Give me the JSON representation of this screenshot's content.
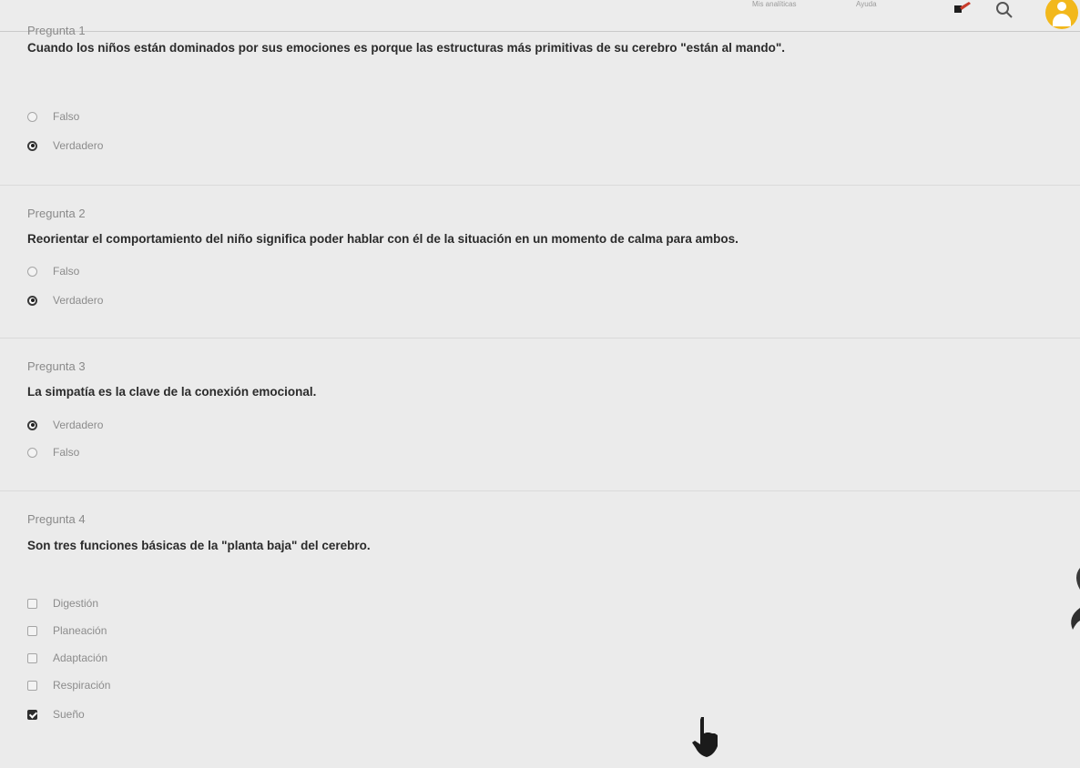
{
  "topbar": {
    "results_link": "Mis analíticas",
    "help_link": "Ayuda",
    "icons": [
      "notification-icon",
      "search-icon",
      "user-avatar"
    ]
  },
  "questions": [
    {
      "number": "Pregunta 1",
      "text": "Cuando los niños están dominados por sus emociones es porque las estructuras más primitivas de su cerebro \"están al mando\".",
      "type": "radio",
      "options": [
        {
          "label": "Falso",
          "checked": false
        },
        {
          "label": "Verdadero",
          "checked": true
        }
      ]
    },
    {
      "number": "Pregunta 2",
      "text": "Reorientar el comportamiento del niño significa poder hablar con él de la situación en un momento de calma para ambos.",
      "type": "radio",
      "options": [
        {
          "label": "Falso",
          "checked": false
        },
        {
          "label": "Verdadero",
          "checked": true
        }
      ]
    },
    {
      "number": "Pregunta 3",
      "text": "La simpatía es la clave de la conexión emocional.",
      "type": "radio",
      "options": [
        {
          "label": "Verdadero",
          "checked": true
        },
        {
          "label": "Falso",
          "checked": false
        }
      ]
    },
    {
      "number": "Pregunta 4",
      "text": "Son tres funciones básicas de la \"planta baja\" del cerebro.",
      "type": "checkbox",
      "options": [
        {
          "label": "Digestión",
          "checked": false
        },
        {
          "label": "Planeación",
          "checked": false
        },
        {
          "label": "Adaptación",
          "checked": false
        },
        {
          "label": "Respiración",
          "checked": false
        },
        {
          "label": "Sueño",
          "checked": true
        }
      ]
    }
  ]
}
